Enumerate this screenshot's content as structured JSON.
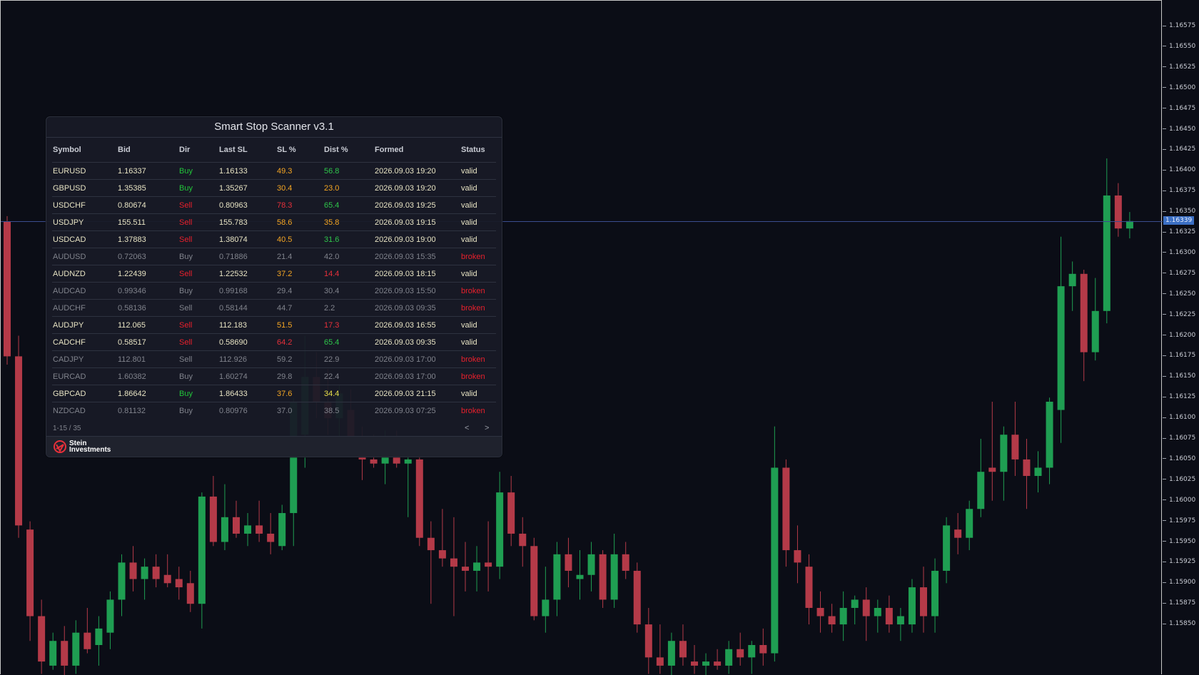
{
  "panel": {
    "title": "Smart Stop Scanner v3.1",
    "columns": [
      "Symbol",
      "Bid",
      "Dir",
      "Last SL",
      "SL %",
      "Dist %",
      "Formed",
      "Status"
    ],
    "rows": [
      {
        "symbol": "EURUSD",
        "bid": "1.16337",
        "dir": "Buy",
        "last_sl": "1.16133",
        "sl_pct": "49.3",
        "dist_pct": "56.8",
        "formed": "2026.09.03 19:20",
        "status": "valid",
        "sl_color": "orange",
        "dist_color": "green"
      },
      {
        "symbol": "GBPUSD",
        "bid": "1.35385",
        "dir": "Buy",
        "last_sl": "1.35267",
        "sl_pct": "30.4",
        "dist_pct": "23.0",
        "formed": "2026.09.03 19:20",
        "status": "valid",
        "sl_color": "orange",
        "dist_color": "orange"
      },
      {
        "symbol": "USDCHF",
        "bid": "0.80674",
        "dir": "Sell",
        "last_sl": "0.80963",
        "sl_pct": "78.3",
        "dist_pct": "65.4",
        "formed": "2026.09.03 19:25",
        "status": "valid",
        "sl_color": "red",
        "dist_color": "green"
      },
      {
        "symbol": "USDJPY",
        "bid": "155.511",
        "dir": "Sell",
        "last_sl": "155.783",
        "sl_pct": "58.6",
        "dist_pct": "35.8",
        "formed": "2026.09.03 19:15",
        "status": "valid",
        "sl_color": "orange",
        "dist_color": "orange"
      },
      {
        "symbol": "USDCAD",
        "bid": "1.37883",
        "dir": "Sell",
        "last_sl": "1.38074",
        "sl_pct": "40.5",
        "dist_pct": "31.6",
        "formed": "2026.09.03 19:00",
        "status": "valid",
        "sl_color": "orange",
        "dist_color": "green"
      },
      {
        "symbol": "AUDUSD",
        "bid": "0.72063",
        "dir": "Buy",
        "last_sl": "0.71886",
        "sl_pct": "21.4",
        "dist_pct": "42.0",
        "formed": "2026.09.03 15:35",
        "status": "broken",
        "sl_color": "",
        "dist_color": ""
      },
      {
        "symbol": "AUDNZD",
        "bid": "1.22439",
        "dir": "Sell",
        "last_sl": "1.22532",
        "sl_pct": "37.2",
        "dist_pct": "14.4",
        "formed": "2026.09.03 18:15",
        "status": "valid",
        "sl_color": "orange",
        "dist_color": "red"
      },
      {
        "symbol": "AUDCAD",
        "bid": "0.99346",
        "dir": "Buy",
        "last_sl": "0.99168",
        "sl_pct": "29.4",
        "dist_pct": "30.4",
        "formed": "2026.09.03 15:50",
        "status": "broken",
        "sl_color": "",
        "dist_color": ""
      },
      {
        "symbol": "AUDCHF",
        "bid": "0.58136",
        "dir": "Sell",
        "last_sl": "0.58144",
        "sl_pct": "44.7",
        "dist_pct": "2.2",
        "formed": "2026.09.03 09:35",
        "status": "broken",
        "sl_color": "",
        "dist_color": ""
      },
      {
        "symbol": "AUDJPY",
        "bid": "112.065",
        "dir": "Sell",
        "last_sl": "112.183",
        "sl_pct": "51.5",
        "dist_pct": "17.3",
        "formed": "2026.09.03 16:55",
        "status": "valid",
        "sl_color": "orange",
        "dist_color": "red"
      },
      {
        "symbol": "CADCHF",
        "bid": "0.58517",
        "dir": "Sell",
        "last_sl": "0.58690",
        "sl_pct": "64.2",
        "dist_pct": "65.4",
        "formed": "2026.09.03 09:35",
        "status": "valid",
        "sl_color": "red",
        "dist_color": "green"
      },
      {
        "symbol": "CADJPY",
        "bid": "112.801",
        "dir": "Sell",
        "last_sl": "112.926",
        "sl_pct": "59.2",
        "dist_pct": "22.9",
        "formed": "2026.09.03 17:00",
        "status": "broken",
        "sl_color": "",
        "dist_color": ""
      },
      {
        "symbol": "EURCAD",
        "bid": "1.60382",
        "dir": "Buy",
        "last_sl": "1.60274",
        "sl_pct": "29.8",
        "dist_pct": "22.4",
        "formed": "2026.09.03 17:00",
        "status": "broken",
        "sl_color": "",
        "dist_color": ""
      },
      {
        "symbol": "GBPCAD",
        "bid": "1.86642",
        "dir": "Buy",
        "last_sl": "1.86433",
        "sl_pct": "37.6",
        "dist_pct": "34.4",
        "formed": "2026.09.03 21:15",
        "status": "valid",
        "sl_color": "orange",
        "dist_color": "yellow"
      },
      {
        "symbol": "NZDCAD",
        "bid": "0.81132",
        "dir": "Buy",
        "last_sl": "0.80976",
        "sl_pct": "37.0",
        "dist_pct": "38.5",
        "formed": "2026.09.03 07:25",
        "status": "broken",
        "sl_color": "",
        "dist_color": ""
      }
    ],
    "pager_text": "1-15 / 35",
    "prev_label": "<",
    "next_label": ">",
    "logo_line1": "Stein",
    "logo_line2": "Investments",
    "logo_icon": "stein-logo-icon"
  },
  "price_axis": {
    "labels": [
      "1.16575",
      "1.16550",
      "1.16525",
      "1.16500",
      "1.16475",
      "1.16450",
      "1.16425",
      "1.16400",
      "1.16375",
      "1.16350",
      "1.16325",
      "1.16300",
      "1.16275",
      "1.16250",
      "1.16225",
      "1.16200",
      "1.16175",
      "1.16150",
      "1.16125",
      "1.16100",
      "1.16075",
      "1.16050",
      "1.16025",
      "1.16000",
      "1.15975",
      "1.15950",
      "1.15925",
      "1.15900",
      "1.15875",
      "1.15850"
    ],
    "current_price": "1.16339"
  },
  "colors": {
    "background": "#0b0d16",
    "bull": "#1f9e52",
    "bear": "#b43a48",
    "price_line": "#3a4d8f",
    "price_tag": "#3b6fc4"
  },
  "candles_ohlc": [
    {
      "o": 1.16338,
      "h": 1.16345,
      "l": 1.16165,
      "c": 1.16175
    },
    {
      "o": 1.16175,
      "h": 1.162,
      "l": 1.15955,
      "c": 1.1597
    },
    {
      "o": 1.15965,
      "h": 1.15975,
      "l": 1.1583,
      "c": 1.1586
    },
    {
      "o": 1.1586,
      "h": 1.1588,
      "l": 1.1579,
      "c": 1.15805
    },
    {
      "o": 1.158,
      "h": 1.1584,
      "l": 1.15795,
      "c": 1.1583
    },
    {
      "o": 1.1583,
      "h": 1.15848,
      "l": 1.1578,
      "c": 1.158
    },
    {
      "o": 1.158,
      "h": 1.15855,
      "l": 1.1579,
      "c": 1.1584
    },
    {
      "o": 1.1584,
      "h": 1.1587,
      "l": 1.15815,
      "c": 1.1582
    },
    {
      "o": 1.15825,
      "h": 1.1586,
      "l": 1.158,
      "c": 1.15845
    },
    {
      "o": 1.1584,
      "h": 1.1589,
      "l": 1.1582,
      "c": 1.1588
    },
    {
      "o": 1.1588,
      "h": 1.15935,
      "l": 1.1586,
      "c": 1.15925
    },
    {
      "o": 1.15925,
      "h": 1.15945,
      "l": 1.1589,
      "c": 1.15905
    },
    {
      "o": 1.15905,
      "h": 1.1593,
      "l": 1.1588,
      "c": 1.1592
    },
    {
      "o": 1.1592,
      "h": 1.15935,
      "l": 1.15895,
      "c": 1.15905
    },
    {
      "o": 1.1591,
      "h": 1.15935,
      "l": 1.15895,
      "c": 1.159
    },
    {
      "o": 1.15905,
      "h": 1.1592,
      "l": 1.1588,
      "c": 1.15895
    },
    {
      "o": 1.159,
      "h": 1.15915,
      "l": 1.15865,
      "c": 1.15875
    },
    {
      "o": 1.15875,
      "h": 1.1601,
      "l": 1.15845,
      "c": 1.16005
    },
    {
      "o": 1.16005,
      "h": 1.1603,
      "l": 1.15945,
      "c": 1.1595
    },
    {
      "o": 1.1595,
      "h": 1.1602,
      "l": 1.1594,
      "c": 1.1598
    },
    {
      "o": 1.1598,
      "h": 1.16,
      "l": 1.15955,
      "c": 1.1596
    },
    {
      "o": 1.1596,
      "h": 1.15985,
      "l": 1.15945,
      "c": 1.1597
    },
    {
      "o": 1.1597,
      "h": 1.16,
      "l": 1.1595,
      "c": 1.1596
    },
    {
      "o": 1.1596,
      "h": 1.15985,
      "l": 1.15935,
      "c": 1.1595
    },
    {
      "o": 1.15945,
      "h": 1.15995,
      "l": 1.1594,
      "c": 1.15985
    },
    {
      "o": 1.15985,
      "h": 1.16125,
      "l": 1.15945,
      "c": 1.1612
    },
    {
      "o": 1.1608,
      "h": 1.162,
      "l": 1.1604,
      "c": 1.1615
    },
    {
      "o": 1.1615,
      "h": 1.1618,
      "l": 1.161,
      "c": 1.1612
    },
    {
      "o": 1.1612,
      "h": 1.1616,
      "l": 1.1608,
      "c": 1.161
    },
    {
      "o": 1.161,
      "h": 1.1614,
      "l": 1.1606,
      "c": 1.1613
    },
    {
      "o": 1.1611,
      "h": 1.16135,
      "l": 1.16055,
      "c": 1.16075
    },
    {
      "o": 1.16075,
      "h": 1.1609,
      "l": 1.16025,
      "c": 1.1605
    },
    {
      "o": 1.1605,
      "h": 1.1608,
      "l": 1.1604,
      "c": 1.16045
    },
    {
      "o": 1.16045,
      "h": 1.16085,
      "l": 1.1602,
      "c": 1.16075
    },
    {
      "o": 1.16075,
      "h": 1.16085,
      "l": 1.1604,
      "c": 1.16045
    },
    {
      "o": 1.16045,
      "h": 1.16075,
      "l": 1.1598,
      "c": 1.1605
    },
    {
      "o": 1.1605,
      "h": 1.1606,
      "l": 1.15945,
      "c": 1.15955
    },
    {
      "o": 1.15955,
      "h": 1.15975,
      "l": 1.15875,
      "c": 1.1594
    },
    {
      "o": 1.1594,
      "h": 1.1599,
      "l": 1.1592,
      "c": 1.1593
    },
    {
      "o": 1.1593,
      "h": 1.1598,
      "l": 1.1586,
      "c": 1.1592
    },
    {
      "o": 1.1592,
      "h": 1.1595,
      "l": 1.1589,
      "c": 1.15915
    },
    {
      "o": 1.15915,
      "h": 1.15945,
      "l": 1.1589,
      "c": 1.15925
    },
    {
      "o": 1.15925,
      "h": 1.15975,
      "l": 1.1589,
      "c": 1.1592
    },
    {
      "o": 1.1592,
      "h": 1.16035,
      "l": 1.15905,
      "c": 1.1601
    },
    {
      "o": 1.1601,
      "h": 1.1603,
      "l": 1.15945,
      "c": 1.1596
    },
    {
      "o": 1.1596,
      "h": 1.1598,
      "l": 1.1592,
      "c": 1.15945
    },
    {
      "o": 1.15945,
      "h": 1.15955,
      "l": 1.15855,
      "c": 1.1586
    },
    {
      "o": 1.1586,
      "h": 1.1592,
      "l": 1.1584,
      "c": 1.1588
    },
    {
      "o": 1.1588,
      "h": 1.1595,
      "l": 1.1586,
      "c": 1.15935
    },
    {
      "o": 1.15935,
      "h": 1.15955,
      "l": 1.15895,
      "c": 1.15915
    },
    {
      "o": 1.15905,
      "h": 1.1594,
      "l": 1.1588,
      "c": 1.1591
    },
    {
      "o": 1.1591,
      "h": 1.1595,
      "l": 1.1589,
      "c": 1.15935
    },
    {
      "o": 1.15935,
      "h": 1.1594,
      "l": 1.1587,
      "c": 1.1588
    },
    {
      "o": 1.1588,
      "h": 1.1596,
      "l": 1.1587,
      "c": 1.15935
    },
    {
      "o": 1.15935,
      "h": 1.1595,
      "l": 1.15905,
      "c": 1.15915
    },
    {
      "o": 1.15915,
      "h": 1.15925,
      "l": 1.1584,
      "c": 1.1585
    },
    {
      "o": 1.1585,
      "h": 1.1587,
      "l": 1.1579,
      "c": 1.1581
    },
    {
      "o": 1.1581,
      "h": 1.1585,
      "l": 1.1579,
      "c": 1.158
    },
    {
      "o": 1.158,
      "h": 1.1584,
      "l": 1.1578,
      "c": 1.1583
    },
    {
      "o": 1.1583,
      "h": 1.1585,
      "l": 1.158,
      "c": 1.1581
    },
    {
      "o": 1.15805,
      "h": 1.15825,
      "l": 1.1579,
      "c": 1.158
    },
    {
      "o": 1.158,
      "h": 1.15815,
      "l": 1.1578,
      "c": 1.15805
    },
    {
      "o": 1.15805,
      "h": 1.1582,
      "l": 1.15795,
      "c": 1.158
    },
    {
      "o": 1.158,
      "h": 1.1583,
      "l": 1.1579,
      "c": 1.1582
    },
    {
      "o": 1.1582,
      "h": 1.1584,
      "l": 1.158,
      "c": 1.1581
    },
    {
      "o": 1.1581,
      "h": 1.1583,
      "l": 1.1579,
      "c": 1.15825
    },
    {
      "o": 1.15825,
      "h": 1.15845,
      "l": 1.158,
      "c": 1.15815
    },
    {
      "o": 1.15815,
      "h": 1.1609,
      "l": 1.15805,
      "c": 1.1604
    },
    {
      "o": 1.1604,
      "h": 1.1605,
      "l": 1.1592,
      "c": 1.1594
    },
    {
      "o": 1.1594,
      "h": 1.1597,
      "l": 1.159,
      "c": 1.15925
    },
    {
      "o": 1.1592,
      "h": 1.15935,
      "l": 1.1585,
      "c": 1.1587
    },
    {
      "o": 1.1587,
      "h": 1.1589,
      "l": 1.1584,
      "c": 1.1586
    },
    {
      "o": 1.1586,
      "h": 1.15875,
      "l": 1.1584,
      "c": 1.1585
    },
    {
      "o": 1.1585,
      "h": 1.1589,
      "l": 1.1583,
      "c": 1.1587
    },
    {
      "o": 1.1587,
      "h": 1.15885,
      "l": 1.1585,
      "c": 1.1588
    },
    {
      "o": 1.1588,
      "h": 1.15895,
      "l": 1.1583,
      "c": 1.1586
    },
    {
      "o": 1.1586,
      "h": 1.1588,
      "l": 1.1584,
      "c": 1.1587
    },
    {
      "o": 1.1587,
      "h": 1.15885,
      "l": 1.1584,
      "c": 1.1585
    },
    {
      "o": 1.1585,
      "h": 1.1587,
      "l": 1.1583,
      "c": 1.1586
    },
    {
      "o": 1.1585,
      "h": 1.15905,
      "l": 1.1584,
      "c": 1.15895
    },
    {
      "o": 1.15895,
      "h": 1.1592,
      "l": 1.1584,
      "c": 1.1586
    },
    {
      "o": 1.1586,
      "h": 1.1593,
      "l": 1.1584,
      "c": 1.15915
    },
    {
      "o": 1.15915,
      "h": 1.1598,
      "l": 1.159,
      "c": 1.1597
    },
    {
      "o": 1.15965,
      "h": 1.15985,
      "l": 1.15935,
      "c": 1.15955
    },
    {
      "o": 1.15955,
      "h": 1.16,
      "l": 1.1594,
      "c": 1.1599
    },
    {
      "o": 1.1599,
      "h": 1.16075,
      "l": 1.1598,
      "c": 1.16035
    },
    {
      "o": 1.1604,
      "h": 1.1612,
      "l": 1.16,
      "c": 1.16035
    },
    {
      "o": 1.16035,
      "h": 1.1609,
      "l": 1.16,
      "c": 1.1608
    },
    {
      "o": 1.1608,
      "h": 1.1612,
      "l": 1.1603,
      "c": 1.1605
    },
    {
      "o": 1.1605,
      "h": 1.16075,
      "l": 1.1599,
      "c": 1.1603
    },
    {
      "o": 1.1603,
      "h": 1.1606,
      "l": 1.1601,
      "c": 1.1604
    },
    {
      "o": 1.1604,
      "h": 1.16125,
      "l": 1.1602,
      "c": 1.1612
    },
    {
      "o": 1.1611,
      "h": 1.1632,
      "l": 1.1607,
      "c": 1.1626
    },
    {
      "o": 1.1626,
      "h": 1.1629,
      "l": 1.1623,
      "c": 1.16275
    },
    {
      "o": 1.16275,
      "h": 1.1628,
      "l": 1.16145,
      "c": 1.1618
    },
    {
      "o": 1.1618,
      "h": 1.1627,
      "l": 1.1617,
      "c": 1.1623
    },
    {
      "o": 1.1623,
      "h": 1.16415,
      "l": 1.16215,
      "c": 1.1637
    },
    {
      "o": 1.1637,
      "h": 1.16385,
      "l": 1.1632,
      "c": 1.1633
    },
    {
      "o": 1.1633,
      "h": 1.1635,
      "l": 1.16318,
      "c": 1.16339
    }
  ]
}
